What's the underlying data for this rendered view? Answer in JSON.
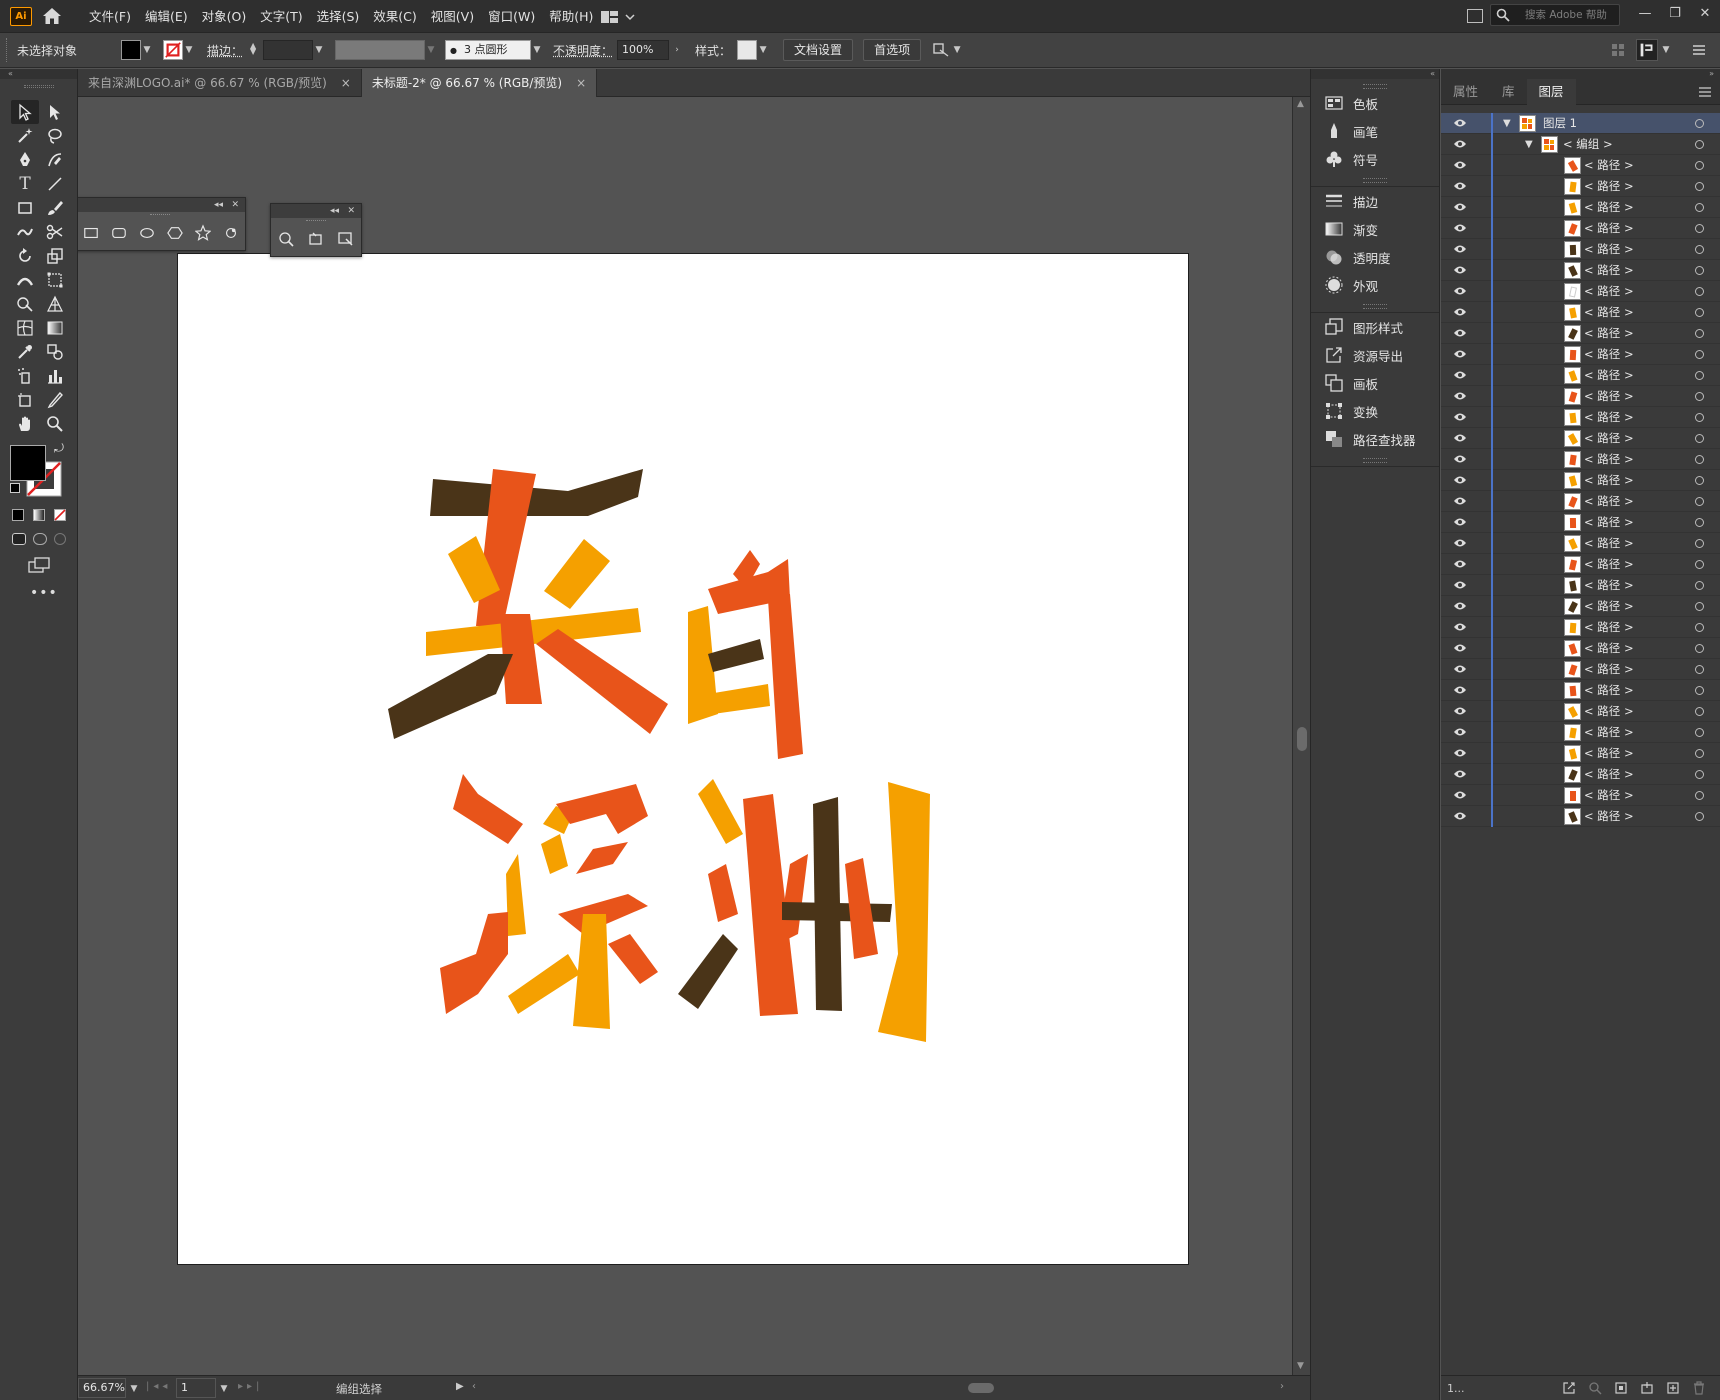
{
  "app": {
    "logo": "Ai",
    "menu": [
      "文件(F)",
      "编辑(E)",
      "对象(O)",
      "文字(T)",
      "选择(S)",
      "效果(C)",
      "视图(V)",
      "窗口(W)",
      "帮助(H)"
    ],
    "search_placeholder": "搜索 Adobe 帮助",
    "window_buttons": [
      "—",
      "❐",
      "✕"
    ]
  },
  "control": {
    "selection_status": "未选择对象",
    "stroke_label": "描边：",
    "stroke_profile": "3 点圆形",
    "opacity_label": "不透明度：",
    "opacity_value": "100%",
    "style_label": "样式：",
    "doc_setup": "文档设置",
    "preferences": "首选项"
  },
  "tabs": [
    {
      "label": "来自深渊LOGO.ai* @ 66.67 % (RGB/预览)",
      "close": "×"
    },
    {
      "label": "未标题-2* @ 66.67 % (RGB/预览)",
      "close": "×"
    }
  ],
  "status": {
    "zoom": "66.67%",
    "artboard_index": "1",
    "tool_name": "编组选择"
  },
  "mid_panel": {
    "group1": [
      {
        "label": "色板",
        "icon": "swatches-icon"
      },
      {
        "label": "画笔",
        "icon": "brush-icon"
      },
      {
        "label": "符号",
        "icon": "symbol-club-icon"
      }
    ],
    "group2": [
      {
        "label": "描边",
        "icon": "stroke-lines-icon"
      },
      {
        "label": "渐变",
        "icon": "gradient-icon"
      },
      {
        "label": "透明度",
        "icon": "transparency-icon"
      },
      {
        "label": "外观",
        "icon": "appearance-icon"
      }
    ],
    "group3": [
      {
        "label": "图形样式",
        "icon": "graphic-styles-icon"
      },
      {
        "label": "资源导出",
        "icon": "asset-export-icon"
      },
      {
        "label": "画板",
        "icon": "artboards-icon"
      },
      {
        "label": "变换",
        "icon": "transform-icon"
      },
      {
        "label": "路径查找器",
        "icon": "pathfinder-icon"
      }
    ]
  },
  "layers": {
    "tabs": [
      "属性",
      "库",
      "图层"
    ],
    "active_tab": "图层",
    "layer_name": "图层 1",
    "group_name": "< 编组 >",
    "path_name": "< 路径 >",
    "path_colors": [
      "#e8541a",
      "#f5a000",
      "#f5a000",
      "#e8541a",
      "#4a3418",
      "#4a3418",
      "#ffffff",
      "#f5a000",
      "#4a3418",
      "#e8541a",
      "#f5a000",
      "#e8541a",
      "#f5a000",
      "#f5a000",
      "#e8541a",
      "#f5a000",
      "#e8541a",
      "#e8541a",
      "#f5a000",
      "#e8541a",
      "#4a3418",
      "#4a3418",
      "#f5a000",
      "#e8541a",
      "#e8541a",
      "#e8541a",
      "#f5a000",
      "#f5a000",
      "#f5a000",
      "#4a3418",
      "#e8541a",
      "#4a3418"
    ],
    "footer_count": "1..."
  },
  "colors": {
    "orange_red": "#e8541a",
    "amber": "#f5a000",
    "brown": "#4a3418",
    "layer_accent": "#4b73c8"
  },
  "artwork": {
    "lines": [
      "来自",
      "深渊"
    ]
  }
}
